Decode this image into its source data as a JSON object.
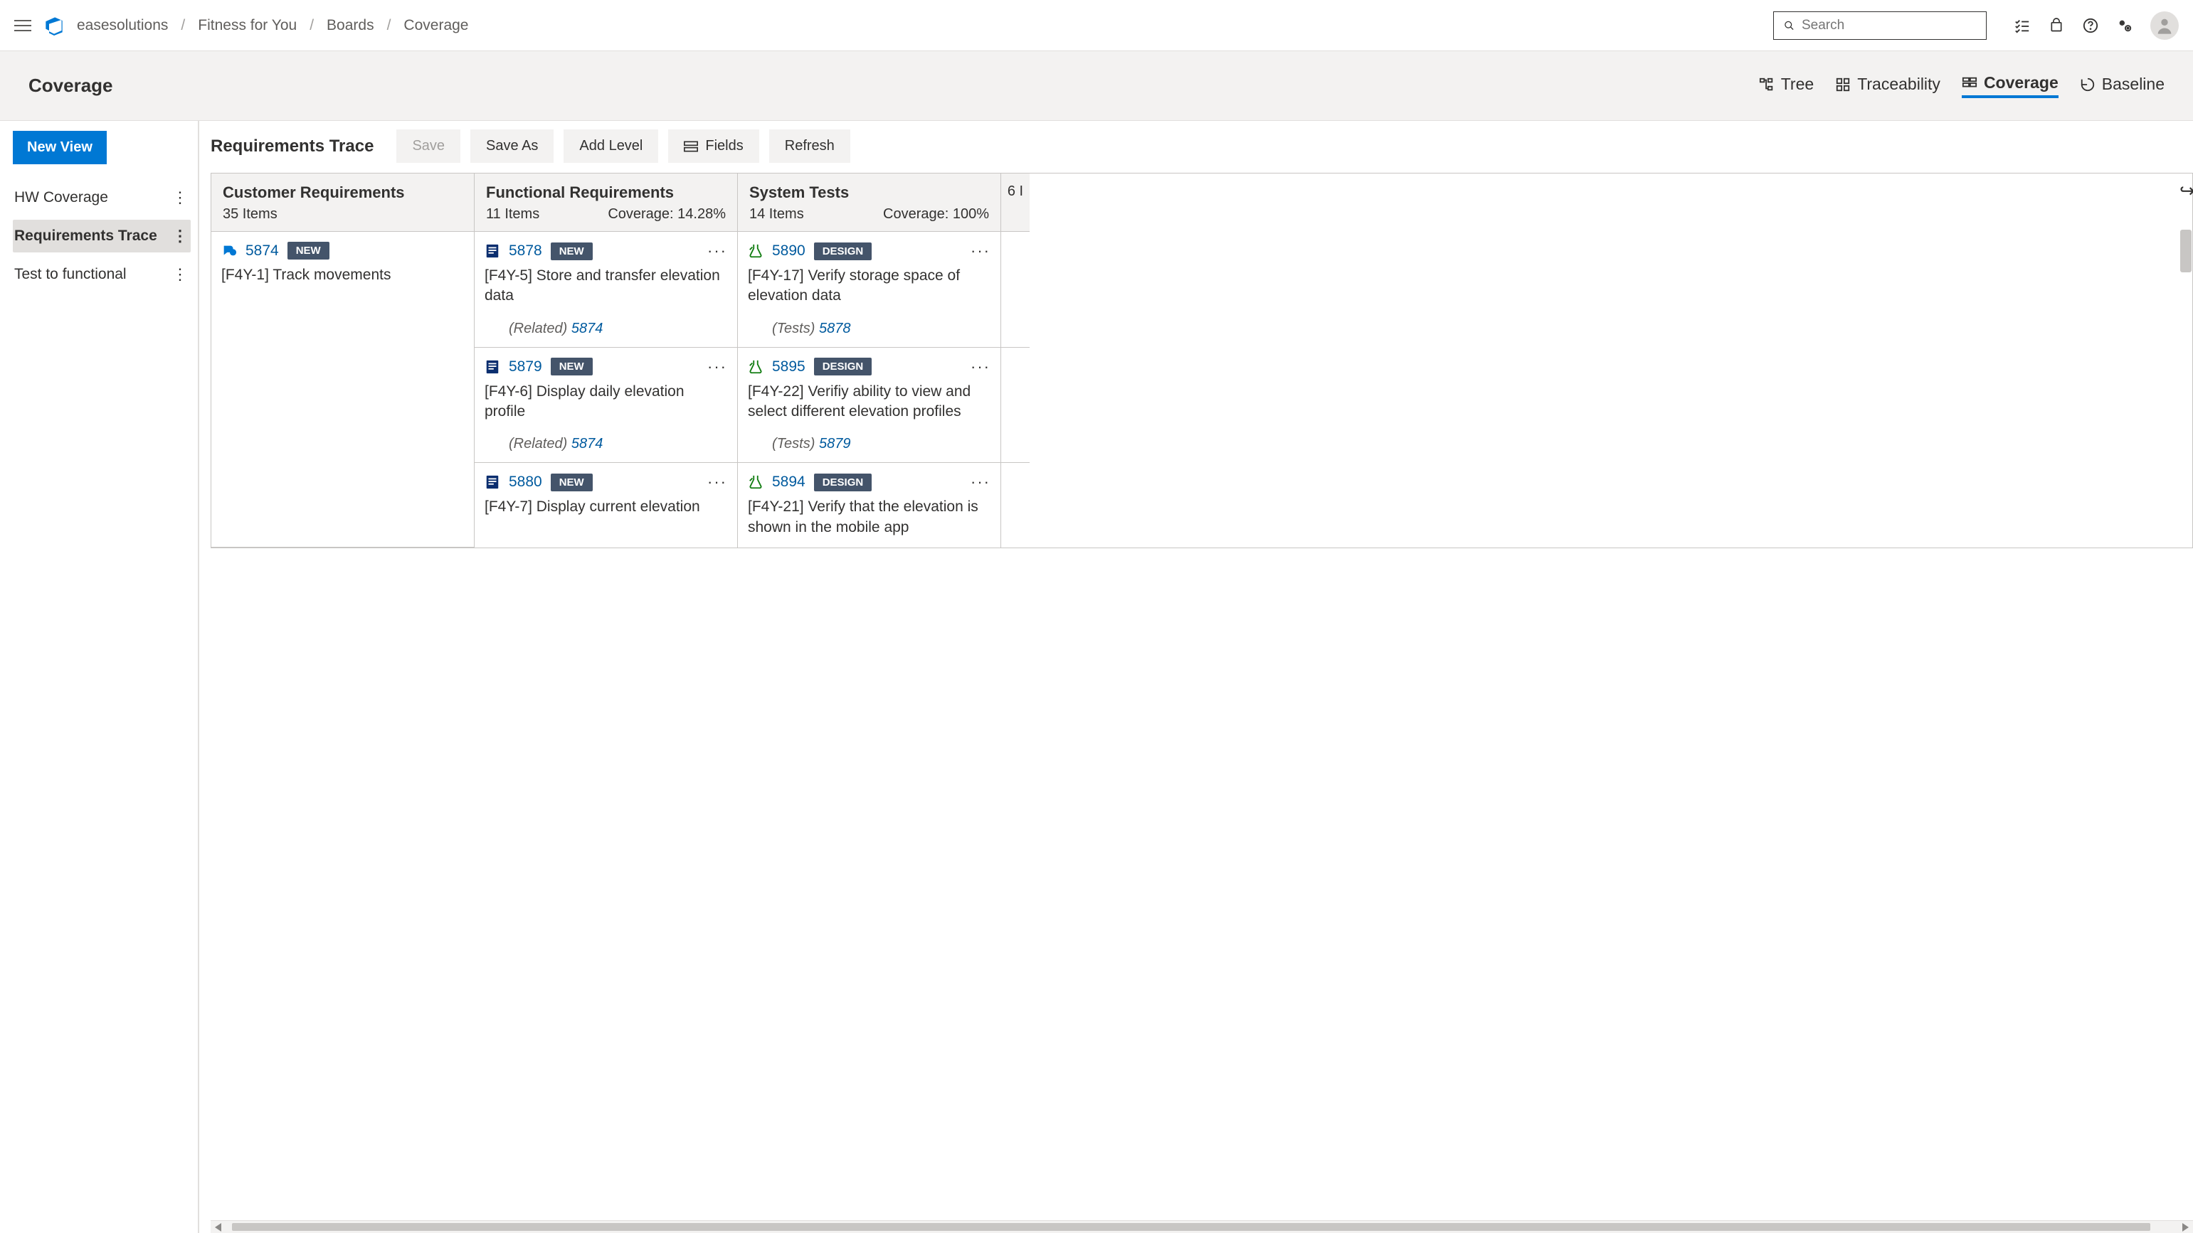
{
  "header": {
    "search_placeholder": "Search"
  },
  "breadcrumb": [
    "easesolutions",
    "Fitness for You",
    "Boards",
    "Coverage"
  ],
  "subheader": {
    "title": "Coverage",
    "views": [
      {
        "label": "Tree"
      },
      {
        "label": "Traceability"
      },
      {
        "label": "Coverage",
        "active": true
      },
      {
        "label": "Baseline"
      }
    ]
  },
  "sidebar": {
    "new_view": "New View",
    "items": [
      {
        "label": "HW Coverage"
      },
      {
        "label": "Requirements Trace",
        "active": true
      },
      {
        "label": "Test to functional"
      }
    ]
  },
  "toolbar": {
    "title": "Requirements Trace",
    "save": "Save",
    "save_as": "Save As",
    "add_level": "Add Level",
    "fields": "Fields",
    "refresh": "Refresh"
  },
  "columns": [
    {
      "title": "Customer Requirements",
      "count": "35 Items",
      "coverage": ""
    },
    {
      "title": "Functional Requirements",
      "count": "11 Items",
      "coverage": "Coverage: 14.28%"
    },
    {
      "title": "System Tests",
      "count": "14 Items",
      "coverage": "Coverage: 100%"
    }
  ],
  "extra_col_hint": "6 I",
  "rows": [
    {
      "cust": {
        "id": "5874",
        "badge": "NEW",
        "title": "[F4Y-1] Track movements"
      },
      "func": {
        "id": "5878",
        "badge": "NEW",
        "title": "[F4Y-5] Store and transfer elevation data",
        "rel_label": "(Related)",
        "rel_id": "5874"
      },
      "sys": {
        "id": "5890",
        "badge": "DESIGN",
        "title": "[F4Y-17] Verify storage space of elevation data",
        "rel_label": "(Tests)",
        "rel_id": "5878"
      }
    },
    {
      "func": {
        "id": "5879",
        "badge": "NEW",
        "title": "[F4Y-6] Display daily elevation profile",
        "rel_label": "(Related)",
        "rel_id": "5874"
      },
      "sys": {
        "id": "5895",
        "badge": "DESIGN",
        "title": "[F4Y-22] Verifiy ability to view and select different elevation profiles",
        "rel_label": "(Tests)",
        "rel_id": "5879"
      }
    },
    {
      "func": {
        "id": "5880",
        "badge": "NEW",
        "title": "[F4Y-7] Display current elevation"
      },
      "sys": {
        "id": "5894",
        "badge": "DESIGN",
        "title": "[F4Y-21] Verify that the elevation is shown in the mobile app"
      }
    }
  ]
}
